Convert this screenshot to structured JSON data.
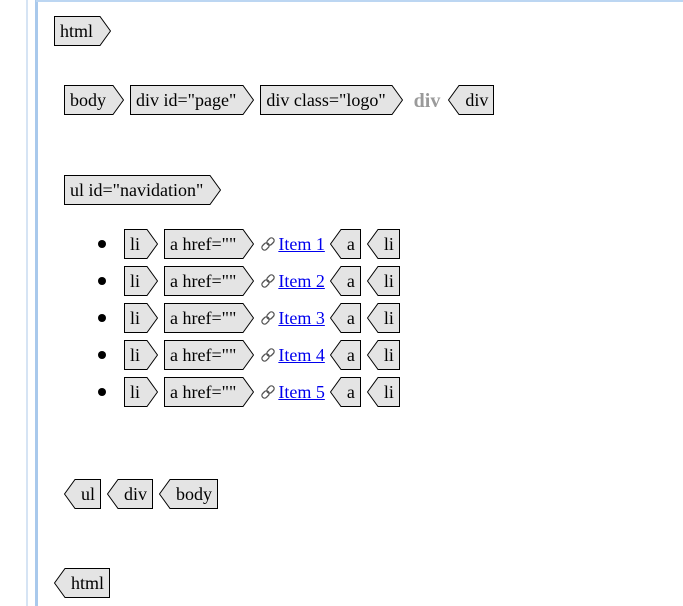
{
  "tags": {
    "html": "html",
    "body": "body",
    "div_page": "div id=\"page\"",
    "div_logo": "div class=\"logo\"",
    "div": "div",
    "ul_nav": "ul id=\"navidation\"",
    "li": "li",
    "a_href": "a href=\"\"",
    "a": "a",
    "ul": "ul"
  },
  "logo_content": "div",
  "nav_items": [
    {
      "label": "Item 1"
    },
    {
      "label": "Item 2"
    },
    {
      "label": "Item 3"
    },
    {
      "label": "Item 4"
    },
    {
      "label": "Item 5"
    }
  ],
  "colors": {
    "tag_fill": "#e4e4e4",
    "tag_border": "#000000",
    "link": "#0000ee",
    "gutter": "#a9c9ec"
  }
}
